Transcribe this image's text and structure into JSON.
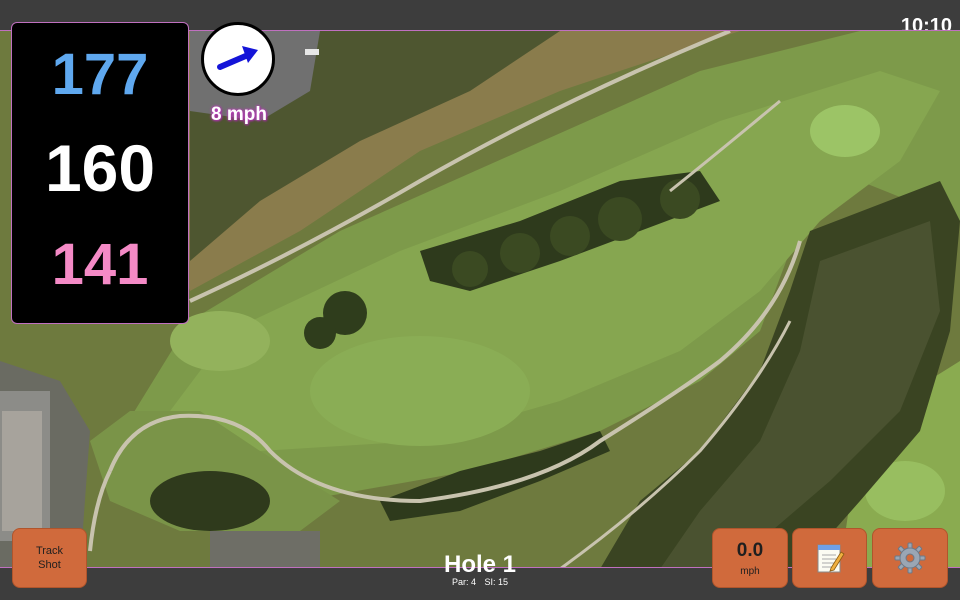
{
  "status": {
    "time": "10:10"
  },
  "distances": {
    "back": "177",
    "middle": "160",
    "front": "141"
  },
  "wind": {
    "speed_label": "8 mph",
    "direction_icon": "wind-arrow-icon"
  },
  "hole": {
    "title": "Hole 1",
    "par_label": "Par: 4",
    "si_label": "SI: 15"
  },
  "buttons": {
    "track_shot": "Track Shot",
    "speed_value": "0.0",
    "speed_unit": "mph",
    "notes_icon": "notepad-icon",
    "settings_icon": "gear-icon"
  },
  "colors": {
    "back_distance": "#5fa8ef",
    "middle_distance": "#ffffff",
    "front_distance": "#f48ac6",
    "button": "#d06a3c",
    "frame_accent": "#c070c0"
  }
}
